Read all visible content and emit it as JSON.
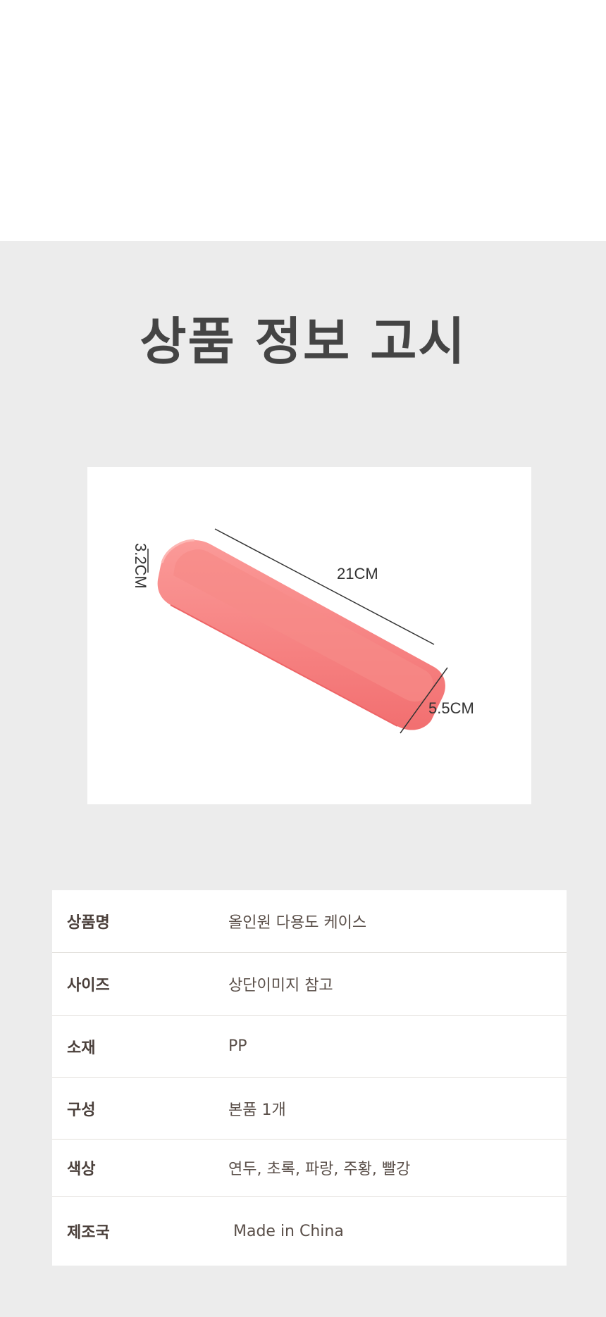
{
  "section": {
    "title": "상품 정보 고시"
  },
  "product_image": {
    "dimensions": {
      "length": "21CM",
      "width": "5.5CM",
      "height": "3.2CM"
    },
    "product_color": "#f97b7b"
  },
  "spec_table": {
    "rows": [
      {
        "label": "상품명",
        "value": "올인원 다용도 케이스"
      },
      {
        "label": "사이즈",
        "value": "상단이미지 참고"
      },
      {
        "label": "소재",
        "value": "PP"
      },
      {
        "label": "구성",
        "value": "본품 1개"
      },
      {
        "label": "색상",
        "value": "연두, 초록, 파랑, 주황, 빨강"
      },
      {
        "label": "제조국",
        "value": " Made in China"
      }
    ]
  },
  "colors": {
    "section_background": "#ececec",
    "title_color": "#444444",
    "text_color": "#4a3f3a"
  }
}
